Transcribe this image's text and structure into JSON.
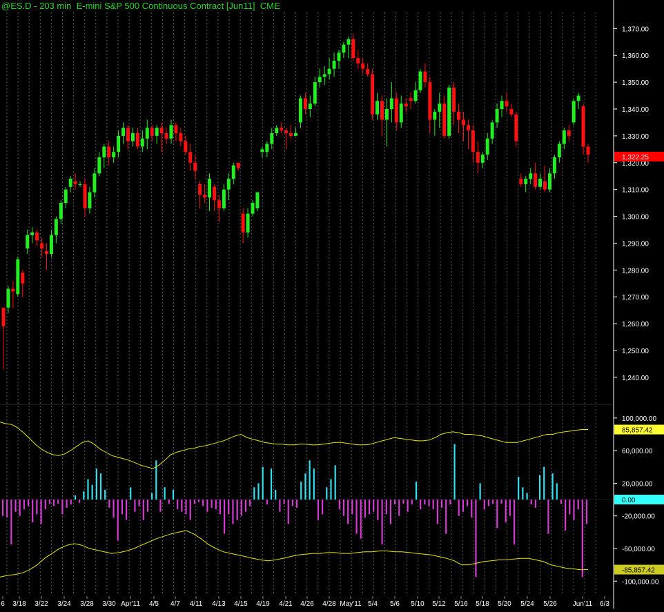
{
  "title": "@ES.D - 203 min  E-mini S&P 500 Continuous Contract [Jun11]  CME",
  "colors": {
    "background": "#000000",
    "title": "#28d428",
    "up": "#22ee22",
    "down": "#ff1111",
    "grid": "#5a5a5a",
    "axis_text": "#ffffff",
    "band": "#e6e600",
    "hist_pos": "#33e0f0",
    "hist_neg": "#d43cd4",
    "last_price_bg": "#ff0000",
    "upper_band_bg": "#ffff33",
    "zero_bg": "#33ffff",
    "lower_band_bg": "#cccc22"
  },
  "labels": {
    "last_price": "1,322.25",
    "upper_band": "85,857.42",
    "zero": "0.00",
    "lower_band": "-85,857.42"
  },
  "chart_data": [
    {
      "type": "candlestick",
      "title": "@ES.D - 203 min  E-mini S&P 500 Continuous Contract [Jun11]  CME",
      "ylim": [
        1232,
        1376
      ],
      "y_ticks": [
        1240,
        1250,
        1260,
        1270,
        1280,
        1290,
        1300,
        1310,
        1320,
        1330,
        1340,
        1350,
        1360,
        1370
      ],
      "y_tick_labels": [
        "1,240.00",
        "1,250.00",
        "1,260.00",
        "1,270.00",
        "1,280.00",
        "1,290.00",
        "1,300.00",
        "1,310.00",
        "1,320.00",
        "1,330.00",
        "1,340.00",
        "1,350.00",
        "1,360.00",
        "1,370.00"
      ],
      "x_tick_labels": [
        "6",
        "3/18",
        "3/22",
        "3/24",
        "3/28",
        "3/30",
        "Apr'11",
        "4/5",
        "4/7",
        "4/11",
        "4/13",
        "4/15",
        "4/19",
        "4/21",
        "4/26",
        "4/28",
        "May'11",
        "5/4",
        "5/6",
        "5/10",
        "5/12",
        "5/16",
        "5/18",
        "5/20",
        "5/24",
        "5/26",
        "Jun'11",
        "6/3"
      ],
      "last_price": 1322.25,
      "grid": true,
      "candles": [
        [
          1266,
          1266,
          1243,
          1259
        ],
        [
          1266,
          1274,
          1264,
          1273
        ],
        [
          1273,
          1276,
          1266,
          1272
        ],
        [
          1271,
          1285,
          1270,
          1284
        ],
        [
          1279,
          1280,
          1270,
          1275
        ],
        [
          1288,
          1295,
          1286,
          1293
        ],
        [
          1293,
          1296,
          1290,
          1294
        ],
        [
          1294,
          1295,
          1289,
          1291
        ],
        [
          1290,
          1292,
          1285,
          1288
        ],
        [
          1287,
          1290,
          1280,
          1286
        ],
        [
          1286,
          1295,
          1285,
          1293
        ],
        [
          1293,
          1300,
          1290,
          1299
        ],
        [
          1299,
          1306,
          1297,
          1305
        ],
        [
          1305,
          1311,
          1303,
          1310
        ],
        [
          1311,
          1315,
          1309,
          1314
        ],
        [
          1313,
          1316,
          1310,
          1312
        ],
        [
          1312,
          1313,
          1311,
          1312
        ],
        [
          1312,
          1314,
          1300,
          1303
        ],
        [
          1303,
          1311,
          1301,
          1309
        ],
        [
          1309,
          1318,
          1307,
          1316
        ],
        [
          1316,
          1324,
          1315,
          1322
        ],
        [
          1322,
          1327,
          1318,
          1326
        ],
        [
          1326,
          1328,
          1319,
          1322
        ],
        [
          1322,
          1326,
          1320,
          1324
        ],
        [
          1324,
          1332,
          1322,
          1330
        ],
        [
          1330,
          1335,
          1327,
          1333
        ],
        [
          1333,
          1334,
          1325,
          1328
        ],
        [
          1328,
          1333,
          1326,
          1331
        ],
        [
          1331,
          1333,
          1325,
          1326
        ],
        [
          1326,
          1332,
          1324,
          1329
        ],
        [
          1329,
          1336,
          1325,
          1333
        ],
        [
          1333,
          1334,
          1328,
          1330
        ],
        [
          1330,
          1334,
          1327,
          1333
        ],
        [
          1333,
          1335,
          1324,
          1331
        ],
        [
          1331,
          1333,
          1327,
          1329
        ],
        [
          1329,
          1336,
          1327,
          1334
        ],
        [
          1334,
          1335,
          1328,
          1331
        ],
        [
          1331,
          1333,
          1326,
          1328
        ],
        [
          1328,
          1330,
          1323,
          1324
        ],
        [
          1324,
          1327,
          1317,
          1320
        ],
        [
          1320,
          1323,
          1314,
          1317
        ],
        [
          1312,
          1313,
          1303,
          1308
        ],
        [
          1308,
          1312,
          1305,
          1307
        ],
        [
          1307,
          1316,
          1302,
          1314
        ],
        [
          1311,
          1312,
          1302,
          1306
        ],
        [
          1306,
          1308,
          1298,
          1303
        ],
        [
          1303,
          1312,
          1302,
          1310
        ],
        [
          1310,
          1316,
          1306,
          1314
        ],
        [
          1314,
          1320,
          1312,
          1319
        ],
        [
          1320,
          1320,
          1317,
          1318
        ],
        [
          1301,
          1303,
          1290,
          1294
        ],
        [
          1294,
          1303,
          1292,
          1301
        ],
        [
          1301,
          1306,
          1300,
          1305
        ],
        [
          1303,
          1309,
          1302,
          1309
        ],
        [
          1324,
          1326,
          1322,
          1325
        ],
        [
          1324,
          1328,
          1322,
          1327
        ],
        [
          1327,
          1333,
          1325,
          1331
        ],
        [
          1331,
          1334,
          1330,
          1333
        ],
        [
          1333,
          1335,
          1331,
          1332
        ],
        [
          1332,
          1333,
          1325,
          1331
        ],
        [
          1331,
          1334,
          1329,
          1330
        ],
        [
          1330,
          1333,
          1330,
          1331
        ],
        [
          1335,
          1345,
          1333,
          1344
        ],
        [
          1344,
          1346,
          1338,
          1340
        ],
        [
          1340,
          1345,
          1337,
          1342
        ],
        [
          1342,
          1352,
          1341,
          1350
        ],
        [
          1350,
          1355,
          1348,
          1352
        ],
        [
          1352,
          1356,
          1349,
          1353
        ],
        [
          1353,
          1359,
          1351,
          1355
        ],
        [
          1355,
          1361,
          1352,
          1358
        ],
        [
          1358,
          1362,
          1355,
          1361
        ],
        [
          1361,
          1365,
          1359,
          1364
        ],
        [
          1364,
          1367,
          1359,
          1366
        ],
        [
          1366,
          1368,
          1358,
          1359
        ],
        [
          1359,
          1362,
          1355,
          1357
        ],
        [
          1357,
          1359,
          1353,
          1355
        ],
        [
          1355,
          1357,
          1352,
          1353
        ],
        [
          1353,
          1355,
          1336,
          1338
        ],
        [
          1338,
          1346,
          1336,
          1343
        ],
        [
          1343,
          1345,
          1330,
          1336
        ],
        [
          1336,
          1344,
          1326,
          1340
        ],
        [
          1340,
          1350,
          1335,
          1344
        ],
        [
          1344,
          1346,
          1332,
          1335
        ],
        [
          1335,
          1345,
          1333,
          1342
        ],
        [
          1342,
          1344,
          1339,
          1341
        ],
        [
          1344,
          1346,
          1340,
          1343
        ],
        [
          1343,
          1350,
          1342,
          1347
        ],
        [
          1347,
          1355,
          1346,
          1354
        ],
        [
          1354,
          1357,
          1348,
          1350
        ],
        [
          1350,
          1352,
          1331,
          1336
        ],
        [
          1336,
          1340,
          1330,
          1339
        ],
        [
          1339,
          1346,
          1333,
          1342
        ],
        [
          1342,
          1345,
          1329,
          1330
        ],
        [
          1330,
          1349,
          1329,
          1348
        ],
        [
          1348,
          1350,
          1334,
          1339
        ],
        [
          1339,
          1342,
          1331,
          1336
        ],
        [
          1336,
          1339,
          1328,
          1334
        ],
        [
          1334,
          1336,
          1325,
          1332
        ],
        [
          1332,
          1334,
          1320,
          1324
        ],
        [
          1324,
          1328,
          1316,
          1320
        ],
        [
          1320,
          1324,
          1318,
          1323
        ],
        [
          1323,
          1331,
          1321,
          1329
        ],
        [
          1329,
          1336,
          1327,
          1335
        ],
        [
          1335,
          1342,
          1333,
          1340
        ],
        [
          1340,
          1345,
          1337,
          1343
        ],
        [
          1343,
          1346,
          1339,
          1341
        ],
        [
          1340,
          1342,
          1337,
          1338
        ],
        [
          1338,
          1339,
          1326,
          1328
        ],
        [
          1314,
          1316,
          1311,
          1312
        ],
        [
          1312,
          1315,
          1309,
          1314
        ],
        [
          1314,
          1318,
          1312,
          1316
        ],
        [
          1316,
          1320,
          1310,
          1311
        ],
        [
          1311,
          1316,
          1310,
          1314
        ],
        [
          1313,
          1319,
          1309,
          1310
        ],
        [
          1310,
          1318,
          1309,
          1316
        ],
        [
          1316,
          1323,
          1314,
          1322
        ],
        [
          1322,
          1328,
          1320,
          1327
        ],
        [
          1327,
          1333,
          1325,
          1332
        ],
        [
          1332,
          1334,
          1328,
          1330
        ],
        [
          1335,
          1344,
          1334,
          1343
        ],
        [
          1343,
          1346,
          1340,
          1345
        ],
        [
          1341,
          1342,
          1323,
          1326
        ],
        [
          1326,
          1327,
          1320,
          1323
        ]
      ]
    },
    {
      "type": "histogram_with_bands",
      "ylim": [
        -115000,
        110000
      ],
      "y_ticks": [
        100000,
        60000,
        20000,
        -20000,
        -60000,
        -100000
      ],
      "y_tick_labels": [
        "100,000.00",
        "60,000.00",
        "20,000.00",
        "-20,000.00",
        "-60,000.00",
        "-100,000.00"
      ],
      "upper_band_last": 85857.42,
      "lower_band_last": -85857.42,
      "histogram": [
        -20000,
        -22000,
        -55000,
        -15000,
        -20000,
        -12000,
        -8000,
        -28000,
        -18000,
        -30000,
        -12000,
        -5000,
        -8000,
        -5000,
        -18000,
        -10000,
        -6000,
        5000,
        -4000,
        10000,
        25000,
        18000,
        38000,
        32000,
        12000,
        -10000,
        -22000,
        -50000,
        -18000,
        -25000,
        15000,
        -15000,
        -8000,
        -25000,
        -15000,
        8000,
        48000,
        -15000,
        15000,
        -5000,
        12000,
        -12000,
        -15000,
        -18000,
        -25000,
        -5000,
        -3000,
        -8000,
        -15000,
        -10000,
        -12000,
        -18000,
        -42000,
        -18000,
        -30000,
        -25000,
        -20000,
        -15000,
        -8000,
        15000,
        20000,
        40000,
        -6000,
        38000,
        12000,
        -15000,
        -5000,
        -30000,
        -8000,
        -10000,
        22000,
        32000,
        48000,
        38000,
        -25000,
        -18000,
        15000,
        25000,
        42000,
        -12000,
        -20000,
        -30000,
        -18000,
        -42000,
        -48000,
        -22000,
        -18000,
        -15000,
        -25000,
        -55000,
        -18000,
        -30000,
        -6000,
        -20000,
        -5000,
        -15000,
        -6000,
        22000,
        -12000,
        -6000,
        -8000,
        -12000,
        -30000,
        -10000,
        -42000,
        -6000,
        68000,
        -20000,
        -15000,
        -8000,
        -22000,
        -95000,
        20000,
        -12000,
        -8000,
        -5000,
        -35000,
        -5000,
        -28000,
        -20000,
        -55000,
        28000,
        15000,
        8000,
        -6000,
        -10000,
        30000,
        40000,
        -42000,
        32000,
        20000,
        -5000,
        -38000,
        -18000,
        -25000,
        -12000,
        -95000,
        -30000
      ],
      "upper_band": [
        95000,
        93000,
        92000,
        88000,
        82000,
        75000,
        68000,
        62000,
        58000,
        55000,
        54000,
        56000,
        60000,
        65000,
        70000,
        72000,
        68000,
        62000,
        58000,
        54000,
        52000,
        50000,
        48000,
        45000,
        42000,
        40000,
        38000,
        42000,
        48000,
        55000,
        58000,
        60000,
        62000,
        63000,
        65000,
        66000,
        68000,
        70000,
        72000,
        75000,
        78000,
        80000,
        76000,
        74000,
        72000,
        70000,
        69000,
        68000,
        68000,
        67000,
        67000,
        68000,
        68000,
        67000,
        67000,
        68000,
        69000,
        70000,
        70000,
        69000,
        68000,
        67000,
        67000,
        68000,
        70000,
        72000,
        74000,
        76000,
        75000,
        74000,
        73000,
        72000,
        72000,
        73000,
        76000,
        80000,
        82000,
        83000,
        82000,
        80000,
        80000,
        79000,
        78000,
        76000,
        74000,
        72000,
        70000,
        70000,
        70000,
        72000,
        74000,
        76000,
        78000,
        80000,
        80000,
        82000,
        83000,
        84000,
        85000,
        86000,
        85857
      ],
      "lower_band": [
        -95000,
        -93000,
        -92000,
        -90000,
        -86000,
        -80000,
        -72000,
        -66000,
        -60000,
        -56000,
        -54000,
        -56000,
        -60000,
        -62000,
        -64000,
        -66000,
        -65000,
        -63000,
        -60000,
        -56000,
        -52000,
        -48000,
        -45000,
        -42000,
        -40000,
        -38000,
        -42000,
        -48000,
        -55000,
        -60000,
        -64000,
        -66000,
        -68000,
        -70000,
        -72000,
        -74000,
        -75000,
        -74000,
        -72000,
        -70000,
        -68000,
        -67000,
        -66000,
        -66000,
        -65000,
        -65000,
        -66000,
        -66000,
        -65000,
        -64000,
        -64000,
        -63000,
        -63000,
        -64000,
        -64000,
        -65000,
        -66000,
        -67000,
        -68000,
        -70000,
        -72000,
        -75000,
        -80000,
        -80000,
        -78000,
        -76000,
        -75000,
        -74000,
        -74000,
        -73000,
        -72000,
        -72000,
        -74000,
        -76000,
        -80000,
        -82000,
        -84000,
        -85000,
        -86000,
        -85857
      ]
    }
  ]
}
